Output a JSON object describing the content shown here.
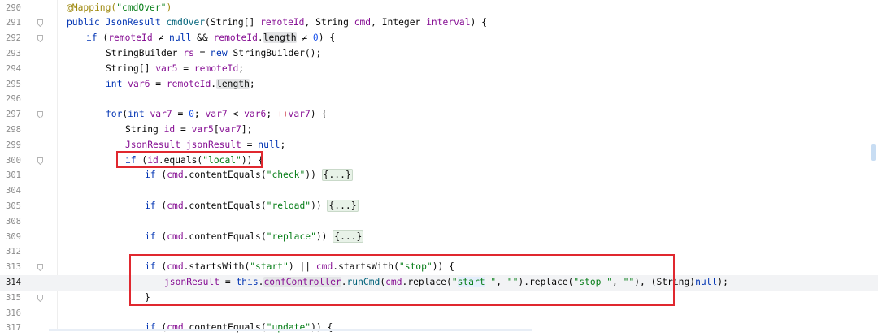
{
  "editor": {
    "lines": [
      {
        "num": "290",
        "current": false,
        "fold": false,
        "segments": [
          [
            "a",
            "@Mapping("
          ],
          [
            "s",
            "\"cmdOver\""
          ],
          [
            "a",
            ")"
          ]
        ],
        "indent": 0
      },
      {
        "num": "291",
        "current": false,
        "fold": true,
        "segments": [
          [
            "k",
            "public "
          ],
          [
            "k",
            "JsonResult "
          ],
          [
            "m",
            "cmdOver"
          ],
          [
            "",
            "(String[] "
          ],
          [
            "f",
            "remoteId"
          ],
          [
            "",
            ", String "
          ],
          [
            "f",
            "cmd"
          ],
          [
            "",
            ", Integer "
          ],
          [
            "f",
            "interval"
          ],
          [
            "",
            ") {"
          ]
        ],
        "indent": 0
      },
      {
        "num": "292",
        "current": false,
        "fold": true,
        "segments": [
          [
            "k",
            "if "
          ],
          [
            "",
            "("
          ],
          [
            "f",
            "remoteId "
          ],
          [
            "",
            "≠ "
          ],
          [
            "k",
            "null "
          ],
          [
            "",
            "&& "
          ],
          [
            "f",
            "remoteId"
          ],
          [
            "",
            "."
          ],
          [
            "hl",
            "length"
          ],
          [
            "",
            " ≠ "
          ],
          [
            "n",
            "0"
          ],
          [
            "",
            ") {"
          ]
        ],
        "indent": 1
      },
      {
        "num": "293",
        "current": false,
        "fold": false,
        "segments": [
          [
            "",
            "StringBuilder "
          ],
          [
            "f",
            "rs "
          ],
          [
            "",
            "= "
          ],
          [
            "k",
            "new "
          ],
          [
            "",
            "StringBuilder();"
          ]
        ],
        "indent": 2
      },
      {
        "num": "294",
        "current": false,
        "fold": false,
        "segments": [
          [
            "",
            "String[] "
          ],
          [
            "f",
            "var5 "
          ],
          [
            "",
            "= "
          ],
          [
            "f",
            "remoteId"
          ],
          [
            "",
            ";"
          ]
        ],
        "indent": 2
      },
      {
        "num": "295",
        "current": false,
        "fold": false,
        "segments": [
          [
            "k",
            "int "
          ],
          [
            "f",
            "var6 "
          ],
          [
            "",
            "= "
          ],
          [
            "f",
            "remoteId"
          ],
          [
            "",
            "."
          ],
          [
            "hl",
            "length"
          ],
          [
            "",
            ";"
          ]
        ],
        "indent": 2
      },
      {
        "num": "296",
        "current": false,
        "fold": false,
        "segments": [],
        "indent": 0
      },
      {
        "num": "297",
        "current": false,
        "fold": true,
        "segments": [
          [
            "k",
            "for"
          ],
          [
            "",
            "("
          ],
          [
            "k",
            "int "
          ],
          [
            "f",
            "var7 "
          ],
          [
            "",
            "= "
          ],
          [
            "n",
            "0"
          ],
          [
            "",
            "; "
          ],
          [
            "f",
            "var7 "
          ],
          [
            "",
            "< "
          ],
          [
            "f",
            "var6"
          ],
          [
            "",
            "; "
          ],
          [
            "fo",
            "++"
          ],
          [
            "f",
            "var7"
          ],
          [
            "",
            ") {"
          ]
        ],
        "indent": 2
      },
      {
        "num": "298",
        "current": false,
        "fold": false,
        "segments": [
          [
            "",
            "String "
          ],
          [
            "f",
            "id "
          ],
          [
            "",
            "= "
          ],
          [
            "f",
            "var5"
          ],
          [
            "",
            "["
          ],
          [
            "f",
            "var7"
          ],
          [
            "",
            "];"
          ]
        ],
        "indent": 3
      },
      {
        "num": "299",
        "current": false,
        "fold": false,
        "segments": [
          [
            "f",
            "JsonResult "
          ],
          [
            "f",
            "jsonResult "
          ],
          [
            "",
            "= "
          ],
          [
            "k",
            "null"
          ],
          [
            "",
            ";"
          ]
        ],
        "indent": 3
      },
      {
        "num": "300",
        "current": false,
        "fold": true,
        "segments": [
          [
            "k",
            "if "
          ],
          [
            "",
            "("
          ],
          [
            "f",
            "id"
          ],
          [
            "",
            ".equals("
          ],
          [
            "s",
            "\"local\""
          ],
          [
            "",
            ")) {"
          ]
        ],
        "indent": 3
      },
      {
        "num": "301",
        "current": false,
        "fold": false,
        "segments": [
          [
            "k",
            "if "
          ],
          [
            "",
            "("
          ],
          [
            "f",
            "cmd"
          ],
          [
            "",
            ".contentEquals("
          ],
          [
            "s",
            "\"check\""
          ],
          [
            "",
            ")) "
          ],
          [
            "fc",
            "{...}"
          ]
        ],
        "indent": 4
      },
      {
        "num": "304",
        "current": false,
        "fold": false,
        "segments": [],
        "indent": 0
      },
      {
        "num": "305",
        "current": false,
        "fold": false,
        "segments": [
          [
            "k",
            "if "
          ],
          [
            "",
            "("
          ],
          [
            "f",
            "cmd"
          ],
          [
            "",
            ".contentEquals("
          ],
          [
            "s",
            "\"reload\""
          ],
          [
            "",
            ")) "
          ],
          [
            "fc",
            "{...}"
          ]
        ],
        "indent": 4
      },
      {
        "num": "308",
        "current": false,
        "fold": false,
        "segments": [],
        "indent": 0
      },
      {
        "num": "309",
        "current": false,
        "fold": false,
        "segments": [
          [
            "k",
            "if "
          ],
          [
            "",
            "("
          ],
          [
            "f",
            "cmd"
          ],
          [
            "",
            ".contentEquals("
          ],
          [
            "s",
            "\"replace\""
          ],
          [
            "",
            ")) "
          ],
          [
            "fc",
            "{...}"
          ]
        ],
        "indent": 4
      },
      {
        "num": "312",
        "current": false,
        "fold": false,
        "segments": [],
        "indent": 0
      },
      {
        "num": "313",
        "current": false,
        "fold": true,
        "segments": [
          [
            "k",
            "if "
          ],
          [
            "",
            "("
          ],
          [
            "f",
            "cmd"
          ],
          [
            "",
            ".startsWith("
          ],
          [
            "s",
            "\"start\""
          ],
          [
            "",
            ") || "
          ],
          [
            "f",
            "cmd"
          ],
          [
            "",
            ".startsWith("
          ],
          [
            "s",
            "\"stop\""
          ],
          [
            "",
            ")) {"
          ]
        ],
        "indent": 4
      },
      {
        "num": "314",
        "current": true,
        "fold": false,
        "segments": [
          [
            "f",
            "jsonResult "
          ],
          [
            "",
            "= "
          ],
          [
            "k",
            "this"
          ],
          [
            "",
            "."
          ],
          [
            "hlf",
            "confController"
          ],
          [
            "",
            "."
          ],
          [
            "m",
            "runCmd"
          ],
          [
            "",
            "("
          ],
          [
            "f",
            "cmd"
          ],
          [
            "",
            ".replace("
          ],
          [
            "s",
            "\""
          ],
          [
            "sh",
            "start"
          ],
          [
            "s",
            " \""
          ],
          [
            "",
            ", "
          ],
          [
            "s",
            "\"\""
          ],
          [
            "",
            ").replace("
          ],
          [
            "s",
            "\"stop \""
          ],
          [
            "",
            ", "
          ],
          [
            "s",
            "\"\""
          ],
          [
            "",
            "), (String)"
          ],
          [
            "k",
            "null"
          ],
          [
            "",
            ");"
          ]
        ],
        "indent": 5
      },
      {
        "num": "315",
        "current": false,
        "fold": true,
        "segments": [
          [
            "",
            "}"
          ]
        ],
        "indent": 4
      },
      {
        "num": "316",
        "current": false,
        "fold": false,
        "segments": [],
        "indent": 0
      },
      {
        "num": "317",
        "current": false,
        "fold": false,
        "segments": [
          [
            "k",
            "if "
          ],
          [
            "",
            "("
          ],
          [
            "f",
            "cmd"
          ],
          [
            "",
            ".contentEquals("
          ],
          [
            "s",
            "\"update\""
          ],
          [
            "",
            ")) {"
          ]
        ],
        "indent": 4
      }
    ]
  },
  "colors": {
    "keyword": "#0033b3",
    "annotation": "#9e880d",
    "string": "#067d17",
    "field": "#871094",
    "method": "#00627a",
    "number": "#1750eb",
    "highlight_box": "#e0282f",
    "current_line": "#f2f3f5"
  }
}
